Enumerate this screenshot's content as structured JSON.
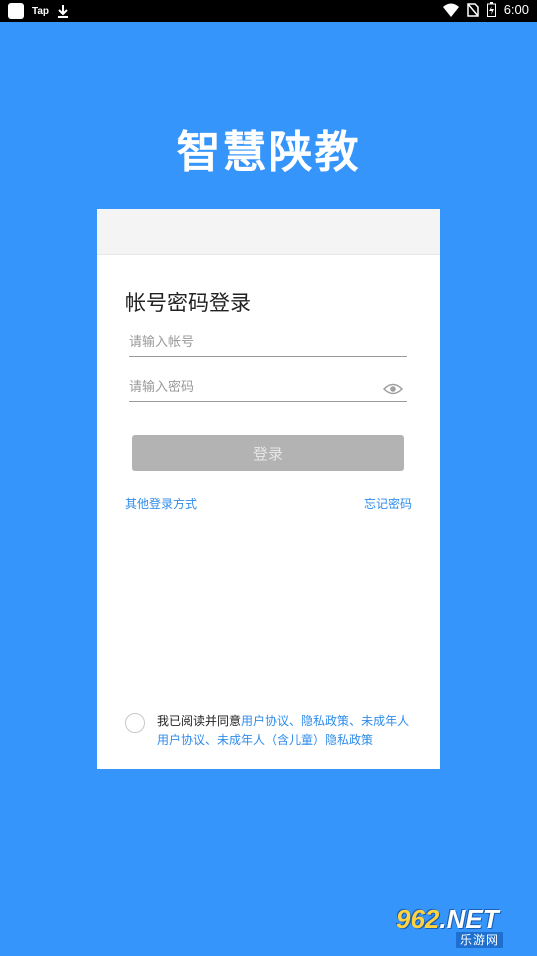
{
  "status_bar": {
    "app_label": "Tap",
    "time": "6:00",
    "icons": [
      "app-square-icon",
      "download-icon",
      "wifi-icon",
      "no-sim-icon",
      "battery-icon"
    ]
  },
  "app": {
    "title": "智慧陕教"
  },
  "login": {
    "heading": "帐号密码登录",
    "account_placeholder": "请输入帐号",
    "password_placeholder": "请输入密码",
    "submit_label": "登录",
    "other_methods_label": "其他登录方式",
    "forgot_password_label": "忘记密码"
  },
  "agreement": {
    "prefix": "我已阅读并同意",
    "user_agreement": "用户协议",
    "sep1": "、",
    "privacy_policy": "隐私政策",
    "sep2": "、",
    "minor_user_agreement": "未成年人用户协议",
    "sep3": "、",
    "minor_privacy_policy": "未成年人（含儿童）隐私政策"
  },
  "watermark": {
    "main_digits": "962",
    "main_suffix": ".NET",
    "sub": "乐游网"
  },
  "colors": {
    "background": "#3595FA",
    "link": "#2E8CEB",
    "disabled_button": "#B3B3B3"
  }
}
